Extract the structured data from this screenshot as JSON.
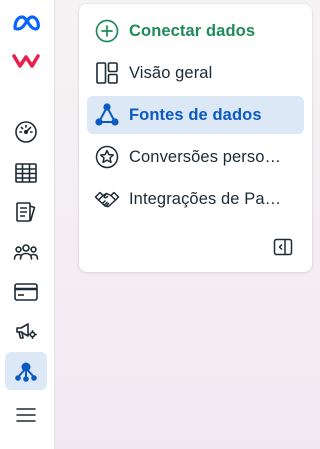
{
  "rail": {
    "icons": [
      {
        "name": "meta-logo-icon"
      },
      {
        "name": "brand-logo-icon"
      },
      {
        "name": "dashboard-gauge-icon"
      },
      {
        "name": "table-grid-icon"
      },
      {
        "name": "documents-icon"
      },
      {
        "name": "audience-people-icon"
      },
      {
        "name": "credit-card-icon"
      },
      {
        "name": "megaphone-settings-icon"
      },
      {
        "name": "data-sources-icon"
      },
      {
        "name": "menu-hamburger-icon"
      }
    ]
  },
  "menu": {
    "items": [
      {
        "label": "Conectar dados",
        "icon": "plus-circle-icon"
      },
      {
        "label": "Visão geral",
        "icon": "overview-layout-icon"
      },
      {
        "label": "Fontes de dados",
        "icon": "data-sources-icon"
      },
      {
        "label": "Conversões perso…",
        "icon": "star-badge-icon"
      },
      {
        "label": "Integrações de Pa…",
        "icon": "handshake-icon"
      }
    ],
    "collapse_icon": "collapse-panel-icon"
  },
  "colors": {
    "primary_green": "#1f8a5b",
    "active_blue": "#0a5ac2",
    "active_bg": "#dde8f6",
    "text": "#1c2b33",
    "meta_blue": "#0866ff",
    "brand_red": "#e8204a"
  }
}
